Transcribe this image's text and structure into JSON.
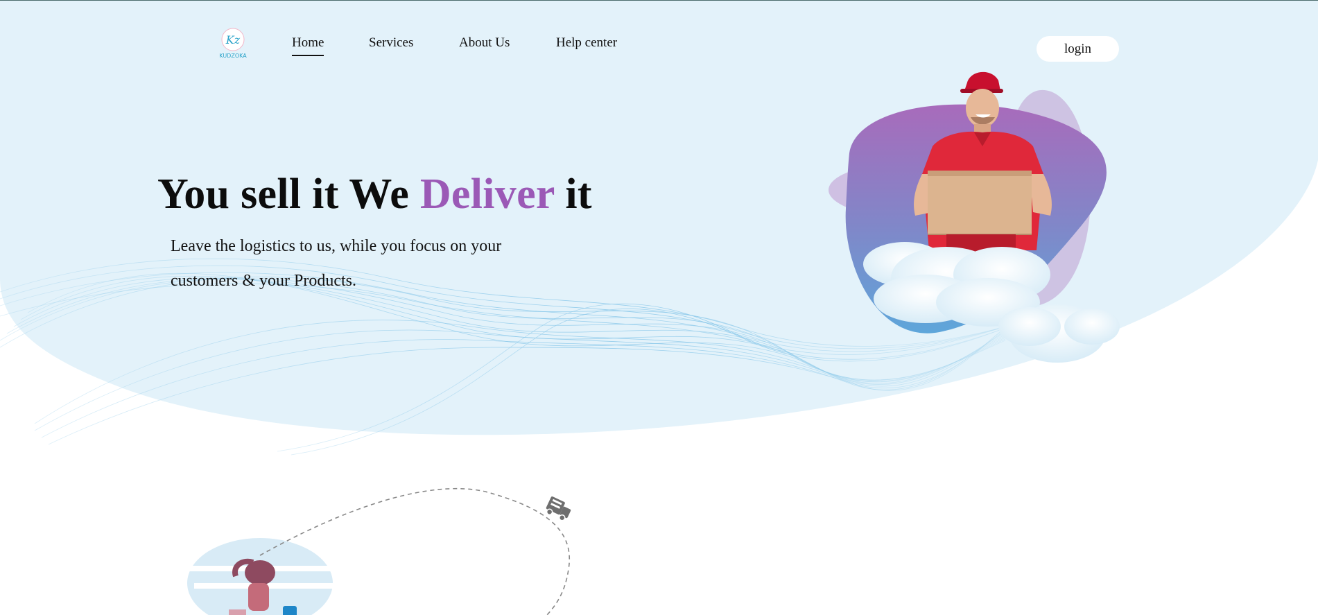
{
  "brand": {
    "logo_monogram": "Kz",
    "logo_name": "KUDZOKA"
  },
  "nav": {
    "items": [
      {
        "label": "Home",
        "active": true
      },
      {
        "label": "Services",
        "active": false
      },
      {
        "label": "About Us",
        "active": false
      },
      {
        "label": "Help center",
        "active": false
      }
    ]
  },
  "login_label": "login",
  "hero": {
    "title_part1": "You sell it We ",
    "title_accent": "Deliver",
    "title_part2": " it",
    "subtitle_line1": "Leave the logistics to us, while you focus on your",
    "subtitle_line2": "customers & your Products."
  },
  "colors": {
    "hero_bg": "#e3f2fa",
    "accent": "#9b59b6",
    "text": "#0c0c0c"
  },
  "icons": {
    "route_vehicle": "delivery-truck-icon"
  }
}
